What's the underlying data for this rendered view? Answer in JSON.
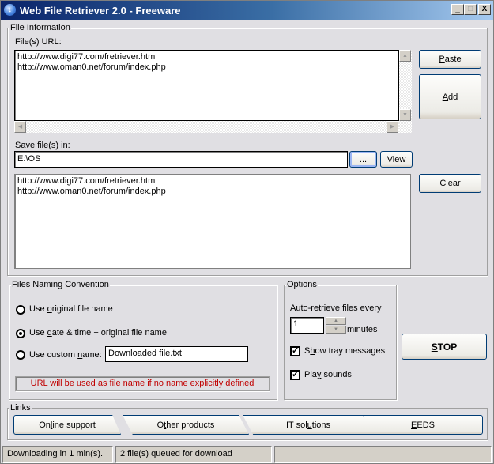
{
  "window": {
    "title": "Web File Retriever 2.0 - Freeware",
    "app_icon": "download-arrow-icon",
    "controls": {
      "minimize": "_",
      "maximize": "□",
      "close": "X"
    }
  },
  "file_info": {
    "group_label": "File Information",
    "urls_label": "File(s) URL:",
    "urls": [
      "http://www.digi77.com/fretriever.htm",
      "http://www.oman0.net/forum/index.php"
    ],
    "paste_button": {
      "pre": "",
      "u": "P",
      "post": "aste"
    },
    "add_button": {
      "pre": "",
      "u": "A",
      "post": "dd"
    },
    "save_label": "Save file(s) in:",
    "save_path": "E:\\OS",
    "browse_button": "...",
    "view_button": "View",
    "queue": [
      "http://www.digi77.com/fretriever.htm",
      "http://www.oman0.net/forum/index.php"
    ],
    "clear_button": {
      "pre": "",
      "u": "C",
      "post": "lear"
    }
  },
  "naming": {
    "group_label": "Files Naming Convention",
    "options": [
      {
        "pre": "Use ",
        "u": "o",
        "post": "riginal file name",
        "checked": false
      },
      {
        "pre": "Use ",
        "u": "d",
        "post": "ate & time + original file name",
        "checked": true
      },
      {
        "pre": "Use custom ",
        "u": "n",
        "post": "ame:",
        "checked": false
      }
    ],
    "custom_name_value": "Downloaded file.txt",
    "note": "URL will be used as file name if no name explicitly defined",
    "note_color": "#c00000"
  },
  "options": {
    "group_label": "Options",
    "auto_retrieve_label": "Auto-retrieve files every",
    "interval_value": "1",
    "interval_unit": "minutes",
    "show_tray": {
      "pre": "S",
      "u": "h",
      "post": "ow tray messages",
      "checked": true
    },
    "play_sounds": {
      "pre": "Pla",
      "u": "y",
      "post": " sounds",
      "checked": true
    }
  },
  "stop_button": {
    "pre": "",
    "u": "S",
    "post": "TOP"
  },
  "links": {
    "group_label": "Links",
    "items": [
      {
        "pre": "On",
        "u": "l",
        "post": "ine support"
      },
      {
        "pre": "O",
        "u": "t",
        "post": "her products"
      },
      {
        "pre": "IT sol",
        "u": "u",
        "post": "tions"
      },
      {
        "pre": "",
        "u": "E",
        "post": "EDS"
      }
    ]
  },
  "status": {
    "cells": [
      "Downloading in 1 min(s).",
      "2 file(s) queued for download",
      ""
    ]
  }
}
